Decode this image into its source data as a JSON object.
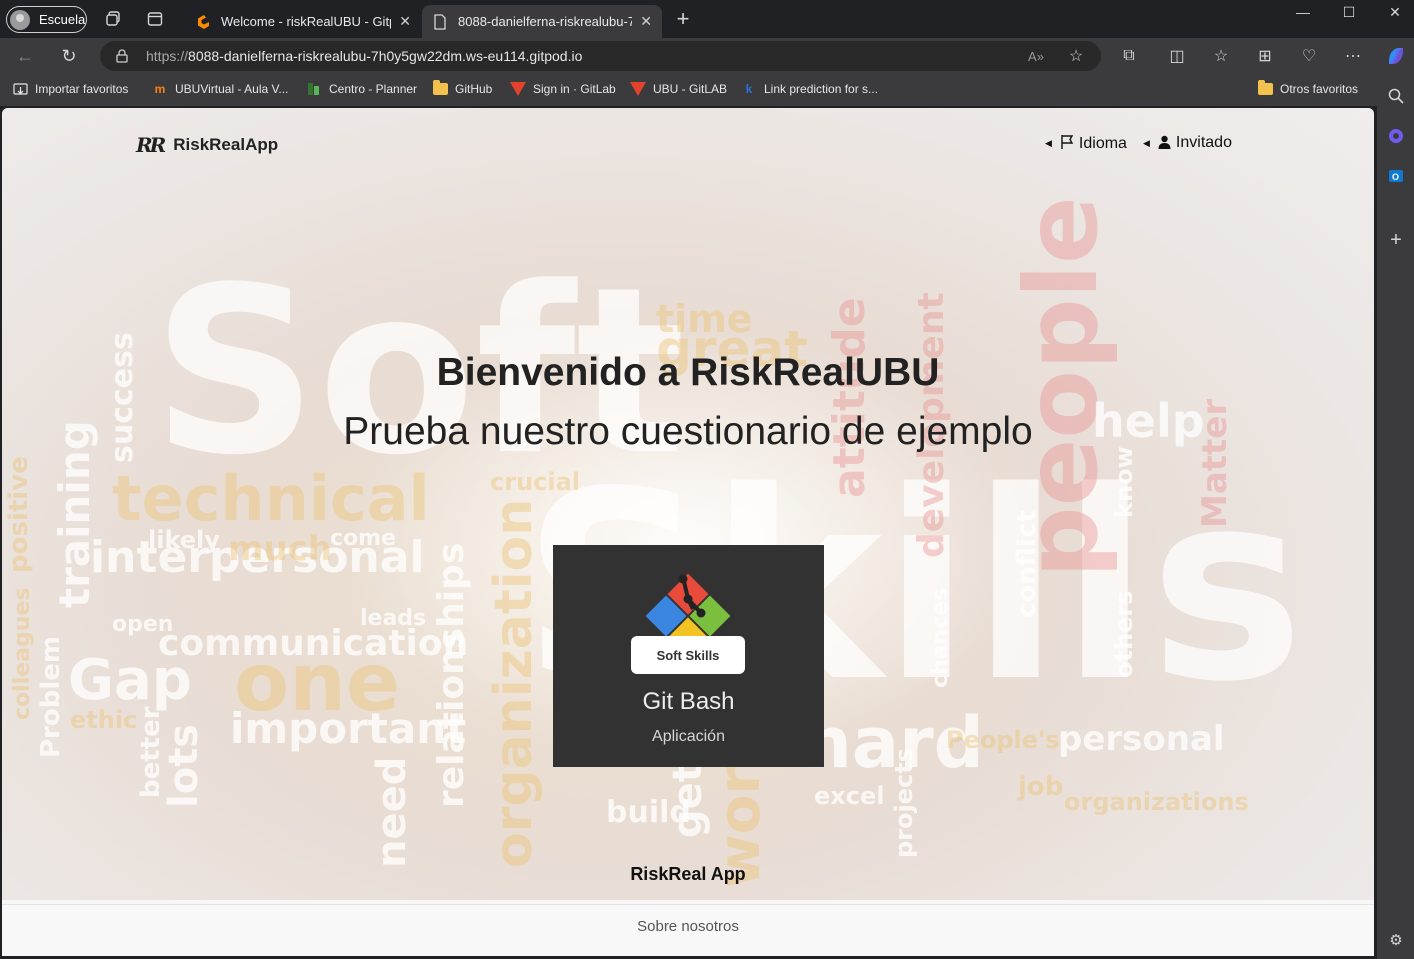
{
  "browser": {
    "profile": "Escuela",
    "tabs": [
      {
        "title": "Welcome - riskRealUBU - Gitpod",
        "active": false
      },
      {
        "title": "8088-danielferna-riskrealubu-7h0y5gw22dm.ws-eu114.gitpod.io",
        "active": true
      }
    ],
    "url_proto": "https://",
    "url_host": "8088-danielferna-riskrealubu-7h0y5gw22dm.ws-eu114.gitpod.io",
    "bookmarks": [
      {
        "label": "Importar favoritos",
        "icon": "import-icon"
      },
      {
        "label": "UBUVirtual - Aula V...",
        "icon": "moodle-icon"
      },
      {
        "label": "Centro - Planner",
        "icon": "planner-icon"
      },
      {
        "label": "GitHub",
        "icon": "folder-icon"
      },
      {
        "label": "Sign in · GitLab",
        "icon": "gitlab-icon"
      },
      {
        "label": "UBU - GitLAB",
        "icon": "gitlab-icon"
      },
      {
        "label": "Link prediction for s...",
        "icon": "k-icon"
      }
    ],
    "other_favorites": "Otros favoritos"
  },
  "page": {
    "brand_mark": "RR",
    "brand_name": "RiskRealApp",
    "nav": {
      "language": "Idioma",
      "user": "Invitado"
    },
    "title": "Bienvenido a RiskRealUBU",
    "subtitle": "Prueba nuestro cuestionario de ejemplo",
    "card": {
      "tag": "Soft Skills",
      "title": "Git Bash",
      "subtitle": "Aplicación"
    },
    "footer_brand": "RiskReal App",
    "footer_link": "Sobre nosotros"
  },
  "background_words": {
    "soft": "Soft",
    "skills": "Skills",
    "people": "people",
    "technical": "technical",
    "interpersonal": "interpersonal",
    "communication": "communication",
    "gap": "Gap",
    "one": "one",
    "important": "important",
    "training": "training",
    "success": "success",
    "organization": "organization",
    "relationships": "relationships",
    "help": "help",
    "time": "time",
    "great": "great",
    "work": "work",
    "hard": "hard",
    "personal": "personal",
    "peoples": "People's",
    "job": "job",
    "organizations": "organizations",
    "build": "build",
    "get": "get",
    "need": "need",
    "lots": "lots",
    "excel": "excel",
    "attitude": "attitude",
    "development": "development",
    "conflict": "conflict",
    "know": "know",
    "matter": "Matter",
    "others": "others",
    "chances": "chances",
    "likely": "likely",
    "much": "much",
    "come": "come",
    "leads": "leads",
    "ethic": "ethic",
    "better": "better",
    "problem": "Problem",
    "colleagues": "colleagues",
    "positive": "positive",
    "crucial": "crucial",
    "open": "open",
    "projects": "projects"
  },
  "colors": {
    "card_bg": "#333233",
    "chrome_bg": "#202124",
    "toolbar_bg": "#3b3b3d"
  }
}
